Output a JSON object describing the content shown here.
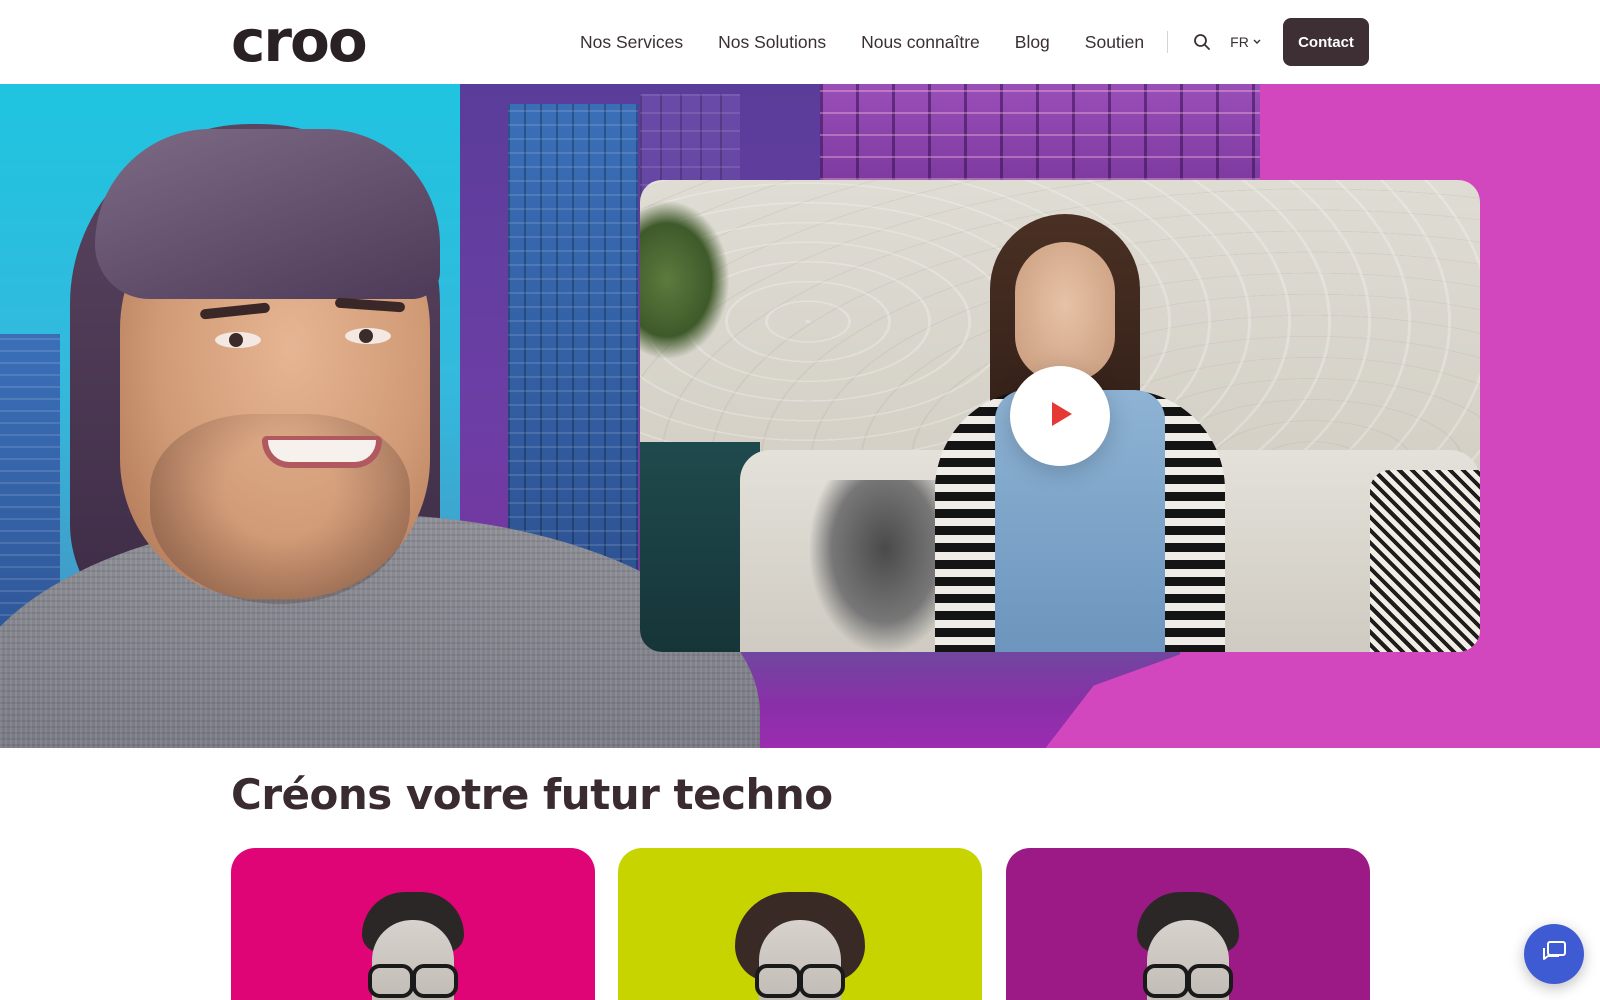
{
  "header": {
    "logo_text": "croo",
    "nav": [
      {
        "label": "Nos Services"
      },
      {
        "label": "Nos Solutions"
      },
      {
        "label": "Nous connaître"
      },
      {
        "label": "Blog"
      },
      {
        "label": "Soutien"
      }
    ],
    "search_icon": "search-icon",
    "language": "FR",
    "contact_label": "Contact"
  },
  "hero": {
    "video_play_icon": "play-icon"
  },
  "section": {
    "title": "Créons votre futur techno"
  },
  "cards": [
    {
      "color": "#df0577"
    },
    {
      "color": "#c8d400"
    },
    {
      "color": "#9c1a86"
    }
  ],
  "chat": {
    "icon": "chat-icon",
    "color": "#3f5bd4"
  },
  "colors": {
    "text_dark": "#2a2124",
    "contact_bg": "#3d2f33",
    "hero_magenta": "#d247be",
    "play_red": "#e53935"
  }
}
